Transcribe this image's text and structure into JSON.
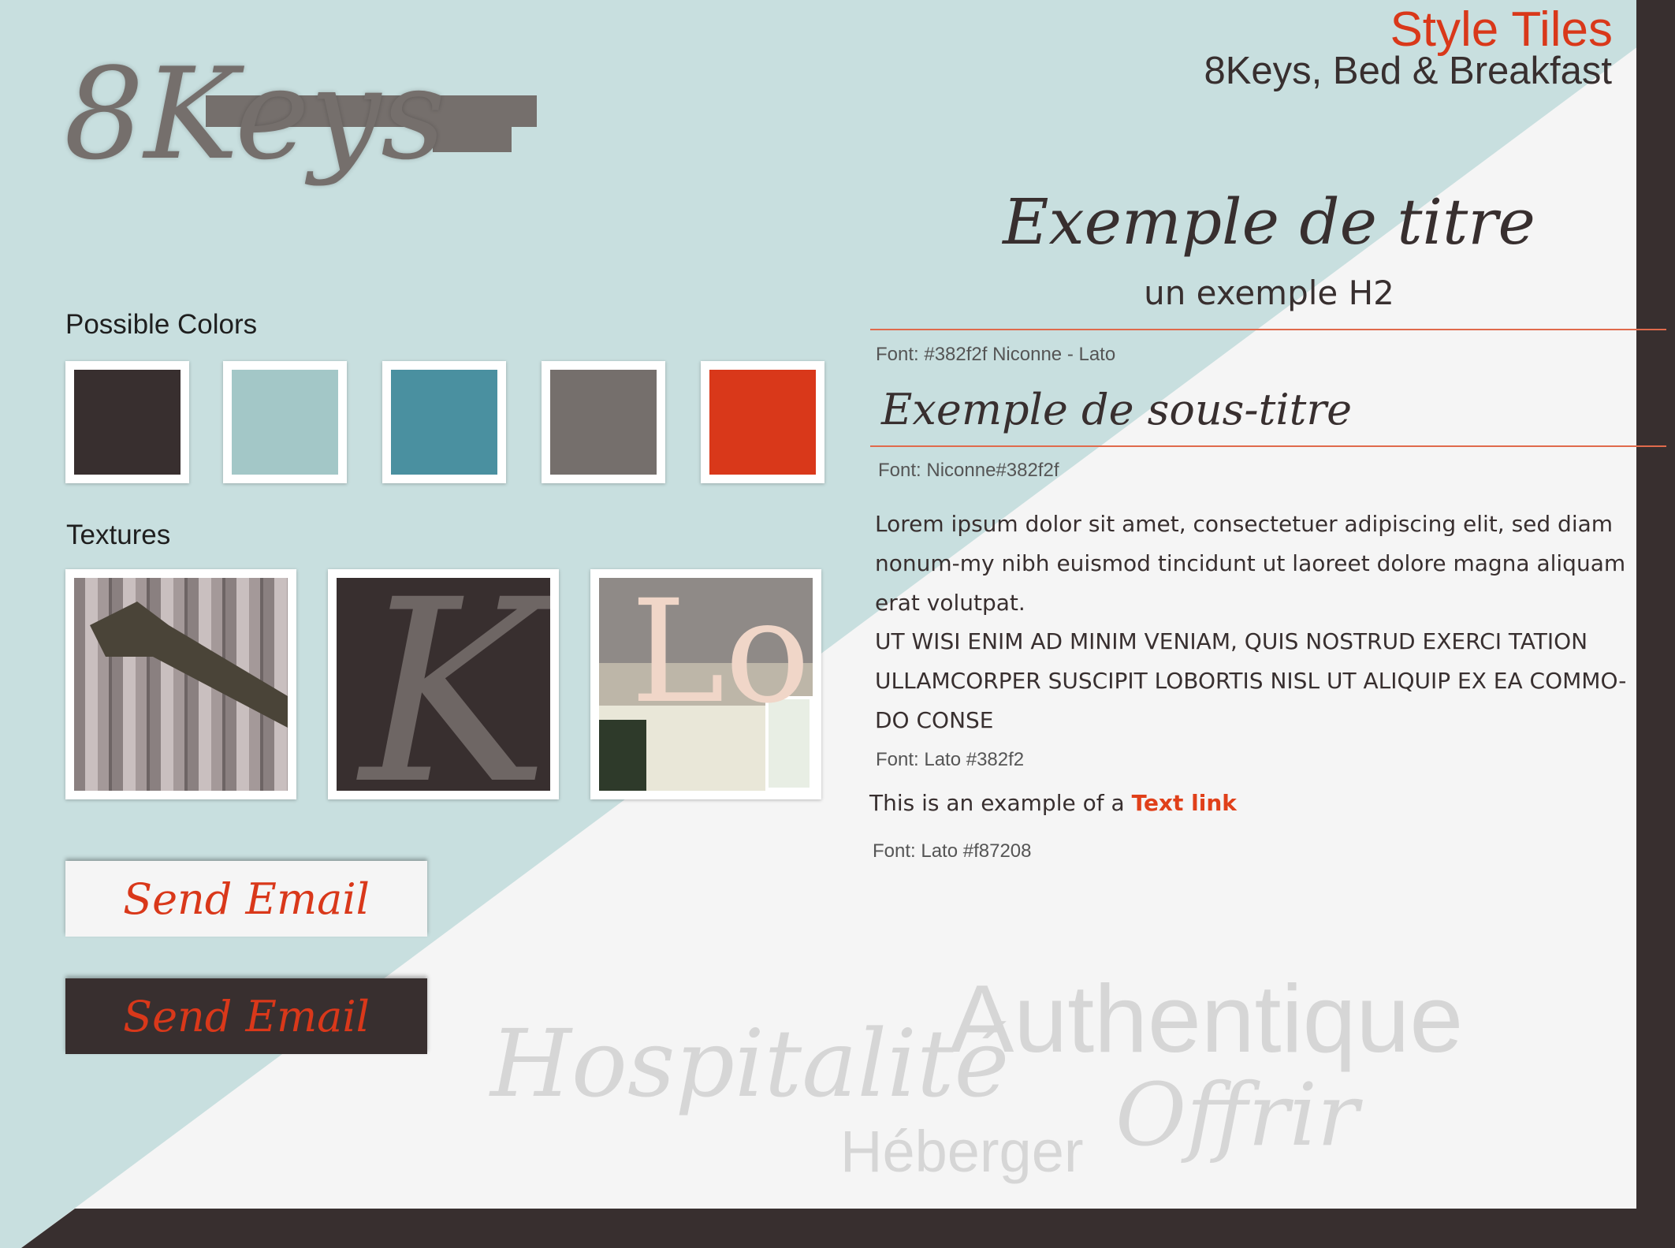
{
  "header": {
    "title": "Style Tiles",
    "subtitle": "8Keys, Bed & Breakfast"
  },
  "logo": {
    "text": "8Keys"
  },
  "colors": {
    "label": "Possible Colors",
    "swatches": [
      "#382f2f",
      "#a3c7c7",
      "#4a90a0",
      "#756f6c",
      "#d9381a"
    ]
  },
  "textures": {
    "label": "Textures",
    "items": [
      {
        "name": "key-on-wood"
      },
      {
        "name": "k-letter",
        "text": "K"
      },
      {
        "name": "lo-photo",
        "text": "Lo"
      }
    ]
  },
  "buttons": {
    "light": "Send Email",
    "dark": "Send Email"
  },
  "typography": {
    "h1": "Exemple de titre",
    "h2": "un exemple H2",
    "note1": "Font: #382f2f Niconne - Lato",
    "h3": "Exemple de sous-titre",
    "note2": "Font: Niconne#382f2f",
    "para1": "Lorem ipsum dolor sit amet, consectetuer adipiscing elit, sed diam nonum-my nibh euismod tincidunt ut laoreet dolore magna aliquam erat volutpat.",
    "para2": "UT WISI ENIM AD MINIM VENIAM, QUIS NOSTRUD EXERCI TATION ULLAMCORPER SUSCIPIT LOBORTIS NISL UT ALIQUIP EX EA COMMO-DO CONSE",
    "note3": "Font: Lato #382f2",
    "link_prefix": "This is an example of a ",
    "link": "Text link",
    "note4": "Font: Lato #f87208"
  },
  "watermarks": {
    "w1": "Authentique",
    "w2": "Hospitalité",
    "w3": "Héberger",
    "w4": "Offrir"
  },
  "palette": {
    "dark": "#382f2f",
    "light_blue": "#c8dfdf",
    "off_white": "#f5f5f5",
    "accent": "#d9381a",
    "gray": "#756f6c"
  }
}
